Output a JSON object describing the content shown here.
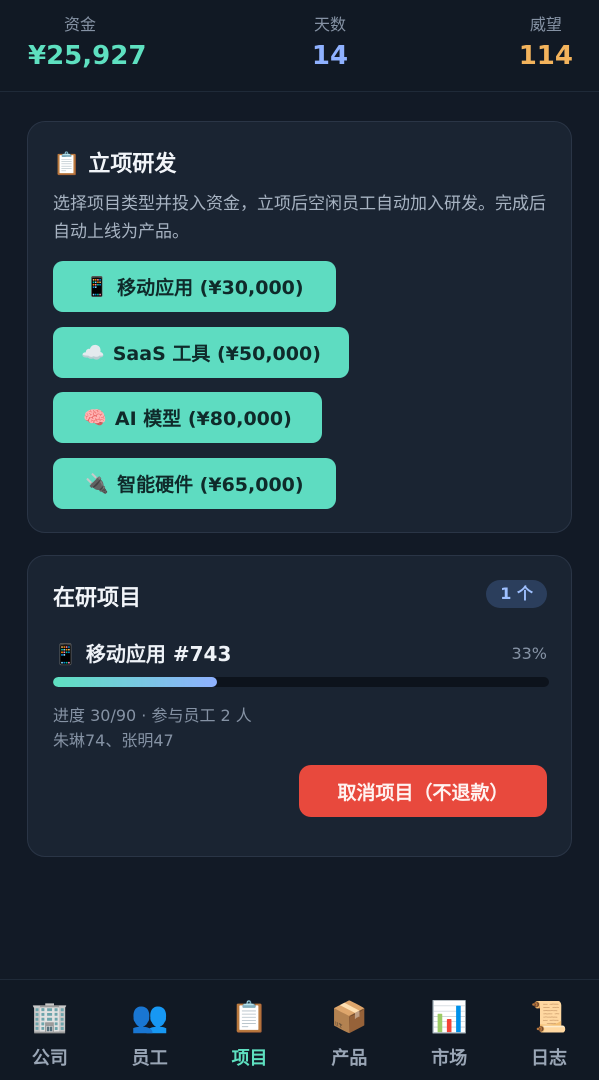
{
  "stats": {
    "money_label": "资金",
    "money_value": "¥25,927",
    "days_label": "天数",
    "days_value": "14",
    "rep_label": "威望",
    "rep_value": "114"
  },
  "new_project": {
    "emoji": "📋",
    "title": "立项研发",
    "description": "选择项目类型并投入资金，立项后空闲员工自动加入研发。完成后自动上线为产品。",
    "options": [
      {
        "emoji": "📱",
        "label": "移动应用 (¥30,000)"
      },
      {
        "emoji": "☁️",
        "label": "SaaS 工具 (¥50,000)"
      },
      {
        "emoji": "🧠",
        "label": "AI 模型 (¥80,000)"
      },
      {
        "emoji": "🔌",
        "label": "智能硬件 (¥65,000)"
      }
    ]
  },
  "active_projects": {
    "title": "在研项目",
    "count_badge": "1 个",
    "item": {
      "emoji": "📱",
      "name": "移动应用 #743",
      "percent_text": "33%",
      "progress": 0.33,
      "meta_line1": "进度 30/90 · 参与员工 2 人",
      "meta_line2": "朱琳74、张明47",
      "cancel_label": "取消项目（不退款）"
    }
  },
  "nav": [
    {
      "icon": "🏢",
      "label": "公司",
      "active": false
    },
    {
      "icon": "👥",
      "label": "员工",
      "active": false
    },
    {
      "icon": "📋",
      "label": "项目",
      "active": true
    },
    {
      "icon": "📦",
      "label": "产品",
      "active": false
    },
    {
      "icon": "📊",
      "label": "市场",
      "active": false
    },
    {
      "icon": "📜",
      "label": "日志",
      "active": false
    }
  ],
  "colors": {
    "accent_teal": "#5edcc1",
    "accent_blue": "#8fb1ff",
    "accent_orange": "#f3b35c",
    "danger_red": "#e8493d"
  }
}
